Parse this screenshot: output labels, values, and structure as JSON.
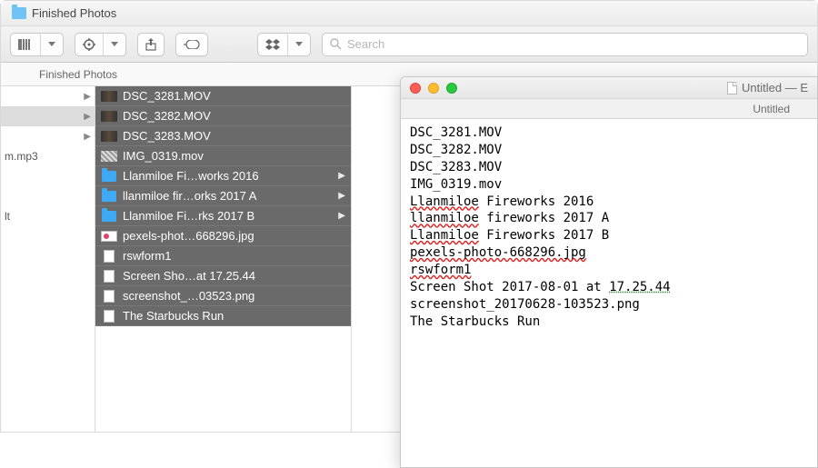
{
  "finder": {
    "title": "Finished Photos",
    "path": "Finished Photos",
    "search_placeholder": "Search",
    "left_items": [
      {
        "label": "",
        "chevron": true,
        "selected": false
      },
      {
        "label": "",
        "chevron": true,
        "selected": true
      },
      {
        "label": "",
        "chevron": true,
        "selected": false
      },
      {
        "label": "m.mp3",
        "chevron": false,
        "selected": false
      },
      {
        "label": "",
        "chevron": false,
        "selected": false
      },
      {
        "label": "",
        "chevron": false,
        "selected": false
      },
      {
        "label": "lt",
        "chevron": false,
        "selected": false
      }
    ],
    "files": [
      {
        "name": "DSC_3281.MOV",
        "icon": "mov",
        "chevron": false
      },
      {
        "name": "DSC_3282.MOV",
        "icon": "mov",
        "chevron": false
      },
      {
        "name": "DSC_3283.MOV",
        "icon": "mov",
        "chevron": false
      },
      {
        "name": "IMG_0319.mov",
        "icon": "mov2",
        "chevron": false
      },
      {
        "name": "Llanmiloe Fi…works 2016",
        "icon": "folder",
        "chevron": true
      },
      {
        "name": "llanmiloe fir…orks 2017 A",
        "icon": "folder",
        "chevron": true
      },
      {
        "name": "Llanmiloe Fi…rks 2017 B",
        "icon": "folder",
        "chevron": true
      },
      {
        "name": "pexels-phot…668296.jpg",
        "icon": "img",
        "chevron": false
      },
      {
        "name": "rswform1",
        "icon": "doc",
        "chevron": false
      },
      {
        "name": "Screen Sho…at 17.25.44",
        "icon": "doc",
        "chevron": false
      },
      {
        "name": "screenshot_…03523.png",
        "icon": "doc",
        "chevron": false
      },
      {
        "name": "The Starbucks Run",
        "icon": "doc",
        "chevron": false
      }
    ]
  },
  "textedit": {
    "title": "Untitled — E",
    "tab": "Untitled",
    "lines": [
      {
        "text": "DSC_3281.MOV"
      },
      {
        "text": "DSC_3282.MOV"
      },
      {
        "text": "DSC_3283.MOV"
      },
      {
        "text": "IMG_0319.mov"
      },
      {
        "spans": [
          {
            "t": "Llanmiloe",
            "c": "spell"
          },
          {
            "t": " Fireworks 2016"
          }
        ]
      },
      {
        "spans": [
          {
            "t": "llanmiloe",
            "c": "spell"
          },
          {
            "t": " fireworks 2017 A"
          }
        ]
      },
      {
        "spans": [
          {
            "t": "Llanmiloe",
            "c": "spell"
          },
          {
            "t": " Fireworks 2017 B"
          }
        ]
      },
      {
        "spans": [
          {
            "t": "pexels-photo-668296.jpg",
            "c": "spell"
          }
        ]
      },
      {
        "spans": [
          {
            "t": "rswform1",
            "c": "spell"
          }
        ]
      },
      {
        "spans": [
          {
            "t": "Screen Shot 2017-08-01 at "
          },
          {
            "t": "17.25.44",
            "c": "gram"
          }
        ]
      },
      {
        "text": "screenshot_20170628-103523.png"
      },
      {
        "text": "The Starbucks Run"
      }
    ]
  }
}
